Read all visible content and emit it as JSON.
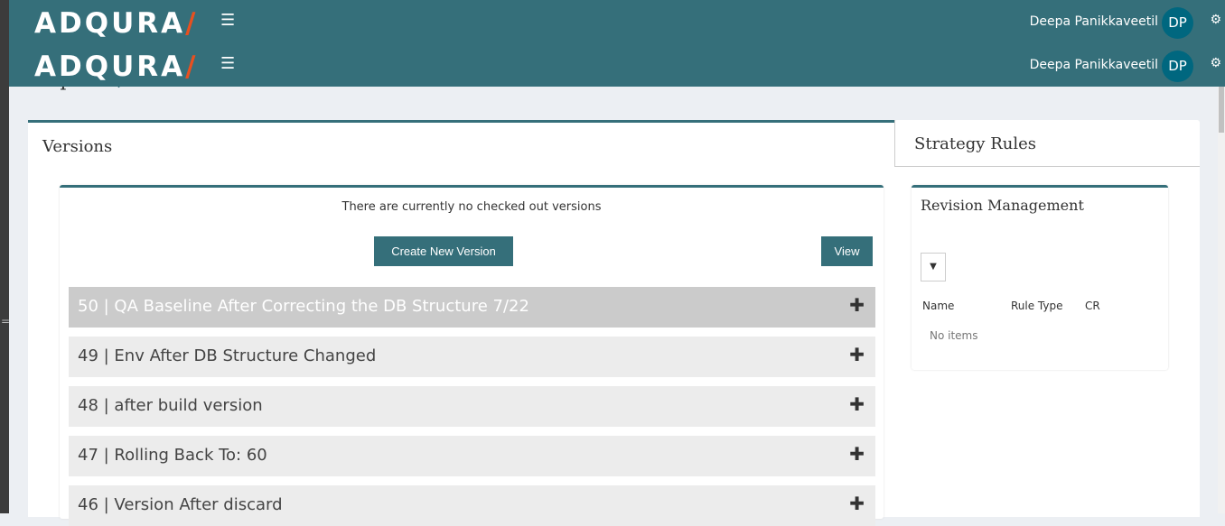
{
  "header": {
    "logo": "ADQURA",
    "logo_slash": "/",
    "user_name": "Deepa Panikkaveetil",
    "avatar_initials": "DP",
    "brand_color": "#356f7a",
    "accent_color": "#e8501f"
  },
  "page": {
    "title": "Sophie"
  },
  "versions": {
    "tab_label": "Versions",
    "message": "There are currently no checked out versions",
    "create_label": "Create New Version",
    "view_label": "View",
    "items": [
      {
        "label": "50 | QA Baseline After Correcting the DB Structure 7/22"
      },
      {
        "label": "49 | Env After DB Structure Changed"
      },
      {
        "label": "48 | after build version"
      },
      {
        "label": "47 | Rolling Back To: 60"
      },
      {
        "label": "46 | Version After discard"
      }
    ]
  },
  "strategy": {
    "tab_label": "Strategy Rules",
    "card_title": "Revision Management",
    "columns": [
      "Name",
      "Rule Type",
      "CR"
    ],
    "empty": "No items"
  }
}
